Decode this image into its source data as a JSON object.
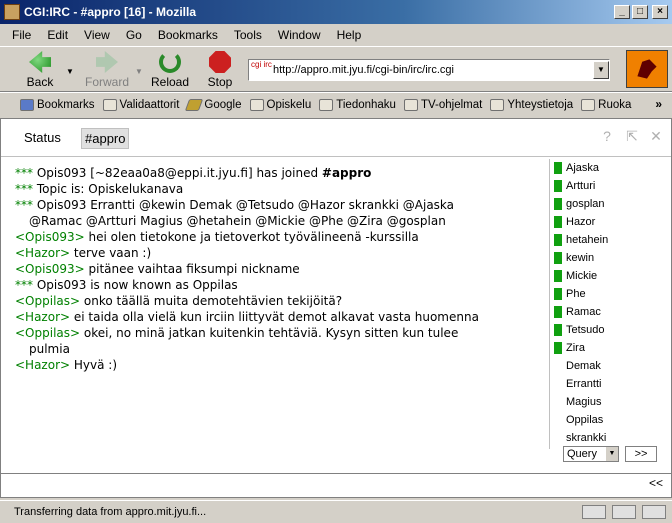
{
  "window": {
    "title": "CGI:IRC - #appro [16]  - Mozilla"
  },
  "menu": [
    "File",
    "Edit",
    "View",
    "Go",
    "Bookmarks",
    "Tools",
    "Window",
    "Help"
  ],
  "nav": {
    "back": "Back",
    "forward": "Forward",
    "reload": "Reload",
    "stop": "Stop",
    "url": "http://appro.mit.jyu.fi/cgi-bin/irc/irc.cgi",
    "site_icon_text": "cgi irc"
  },
  "bookmarks": [
    "Bookmarks",
    "Validaattorit",
    "Google",
    "Opiskelu",
    "Tiedonhaku",
    "TV-ohjelmat",
    "Yhteystietoja",
    "Ruoka"
  ],
  "bookmarks_more": "»",
  "irc": {
    "tabs": {
      "status": "Status",
      "channel": "#appro"
    },
    "tab_icons": [
      "?",
      "⇱",
      "✕"
    ],
    "messages": [
      {
        "prefix": "***",
        "text": "Opis093 [~82eaa0a8@eppi.it.jyu.fi] has joined ",
        "bold": "#appro"
      },
      {
        "prefix": "***",
        "text": "Topic is: Opiskelukanava"
      },
      {
        "prefix": "***",
        "text": "Opis093 Errantti @kewin Demak @Tetsudo @Hazor skrankki @Ajaska"
      },
      {
        "cont": "@Ramac @Artturi Magius @hetahein @Mickie @Phe @Zira @gosplan"
      },
      {
        "nick": "<Opis093>",
        "text": " hei olen tietokone ja tietoverkot työvälineenä -kurssilla"
      },
      {
        "nick": "<Hazor>",
        "text": " terve vaan :)"
      },
      {
        "nick": "<Opis093>",
        "text": " pitänee vaihtaa fiksumpi nickname"
      },
      {
        "prefix": "***",
        "text": "Opis093 is now known as Oppilas"
      },
      {
        "nick": "<Oppilas>",
        "text": " onko täällä muita demotehtävien tekijöitä?"
      },
      {
        "nick": "<Hazor>",
        "text": " ei taida olla vielä kun irciin liittyvät demot alkavat vasta huomenna"
      },
      {
        "nick": "<Oppilas>",
        "text": " okei, no minä jatkan kuitenkin tehtäviä. Kysyn sitten kun tulee"
      },
      {
        "cont": "pulmia"
      },
      {
        "nick": "<Hazor>",
        "text": " Hyvä :)"
      }
    ],
    "nicks": [
      {
        "name": "Ajaska",
        "op": true
      },
      {
        "name": "Artturi",
        "op": true
      },
      {
        "name": "gosplan",
        "op": true
      },
      {
        "name": "Hazor",
        "op": true
      },
      {
        "name": "hetahein",
        "op": true
      },
      {
        "name": "kewin",
        "op": true
      },
      {
        "name": "Mickie",
        "op": true
      },
      {
        "name": "Phe",
        "op": true
      },
      {
        "name": "Ramac",
        "op": true
      },
      {
        "name": "Tetsudo",
        "op": true
      },
      {
        "name": "Zira",
        "op": true
      },
      {
        "name": "Demak",
        "op": false
      },
      {
        "name": "Errantti",
        "op": false
      },
      {
        "name": "Magius",
        "op": false
      },
      {
        "name": "Oppilas",
        "op": false
      },
      {
        "name": "skrankki",
        "op": false
      }
    ],
    "query_label": "Query",
    "go_label": ">>",
    "collapse_label": "<<",
    "input_value": ""
  },
  "status": {
    "text": "Transferring data from appro.mit.jyu.fi..."
  },
  "colors": {
    "green": "#008000",
    "op_marker": "#10a010"
  }
}
